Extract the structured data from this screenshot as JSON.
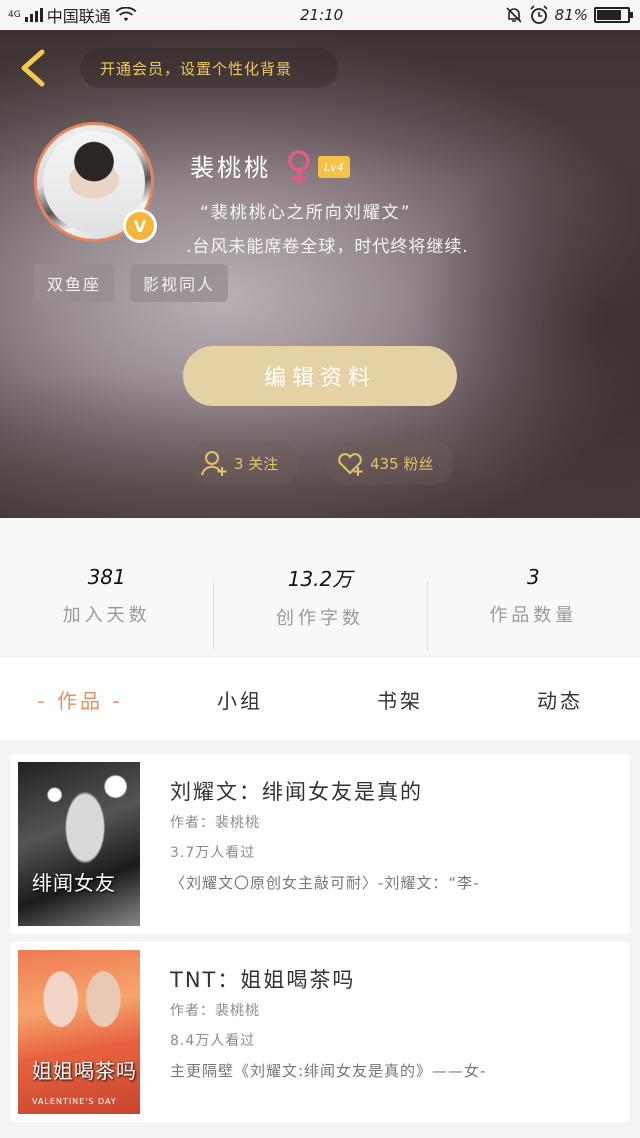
{
  "status_bar": {
    "network": "4G",
    "carrier": "中国联通",
    "time": "21:10",
    "battery_text": "81%",
    "battery_level": 0.81
  },
  "header": {
    "vip_banner": "开通会员，设置个性化背景",
    "username": "裴桃桃",
    "gender": "♀",
    "level": "Lv4",
    "verified_badge": "V",
    "signature_line1": "“裴桃桃心之所向刘耀文”",
    "signature_line2": ".台风未能席卷全球，时代终将继续.",
    "tags": [
      "双鱼座",
      "影视同人"
    ],
    "edit_button": "编辑资料",
    "following": "3 关注",
    "followers": "435 粉丝"
  },
  "stats": [
    {
      "value": "381",
      "label": "加入天数"
    },
    {
      "value": "13.2万",
      "label": "创作字数"
    },
    {
      "value": "3",
      "label": "作品数量"
    }
  ],
  "tabs": [
    {
      "label": "- 作品 -",
      "active": true
    },
    {
      "label": "小组",
      "active": false
    },
    {
      "label": "书架",
      "active": false
    },
    {
      "label": "动态",
      "active": false
    }
  ],
  "works": [
    {
      "title": "刘耀文：绯闻女友是真的",
      "author": "作者：裴桃桃",
      "views": "3.7万人看过",
      "desc": "〈刘耀文〇原创女主敲可耐〉-刘耀文：“李-",
      "cover_title": "绯闻女友"
    },
    {
      "title": "TNT：姐姐喝茶吗",
      "author": "作者：裴桃桃",
      "views": "8.4万人看过",
      "desc": "主更隔壁《刘耀文:绯闻女友是真的》——女-",
      "cover_title": "姐姐喝茶吗",
      "cover_sub": "VALENTINE'S DAY"
    }
  ],
  "colors": {
    "accent": "#e8905e",
    "vip_text": "#f0c85a",
    "edit_button_bg": "#e4d2a4",
    "level_badge": "#f6c243"
  },
  "icons": [
    "back-chevron-icon",
    "female-icon",
    "add-user-icon",
    "heart-plus-icon",
    "wifi-icon",
    "signal-icon",
    "battery-icon",
    "alarm-icon",
    "mute-bell-icon"
  ]
}
